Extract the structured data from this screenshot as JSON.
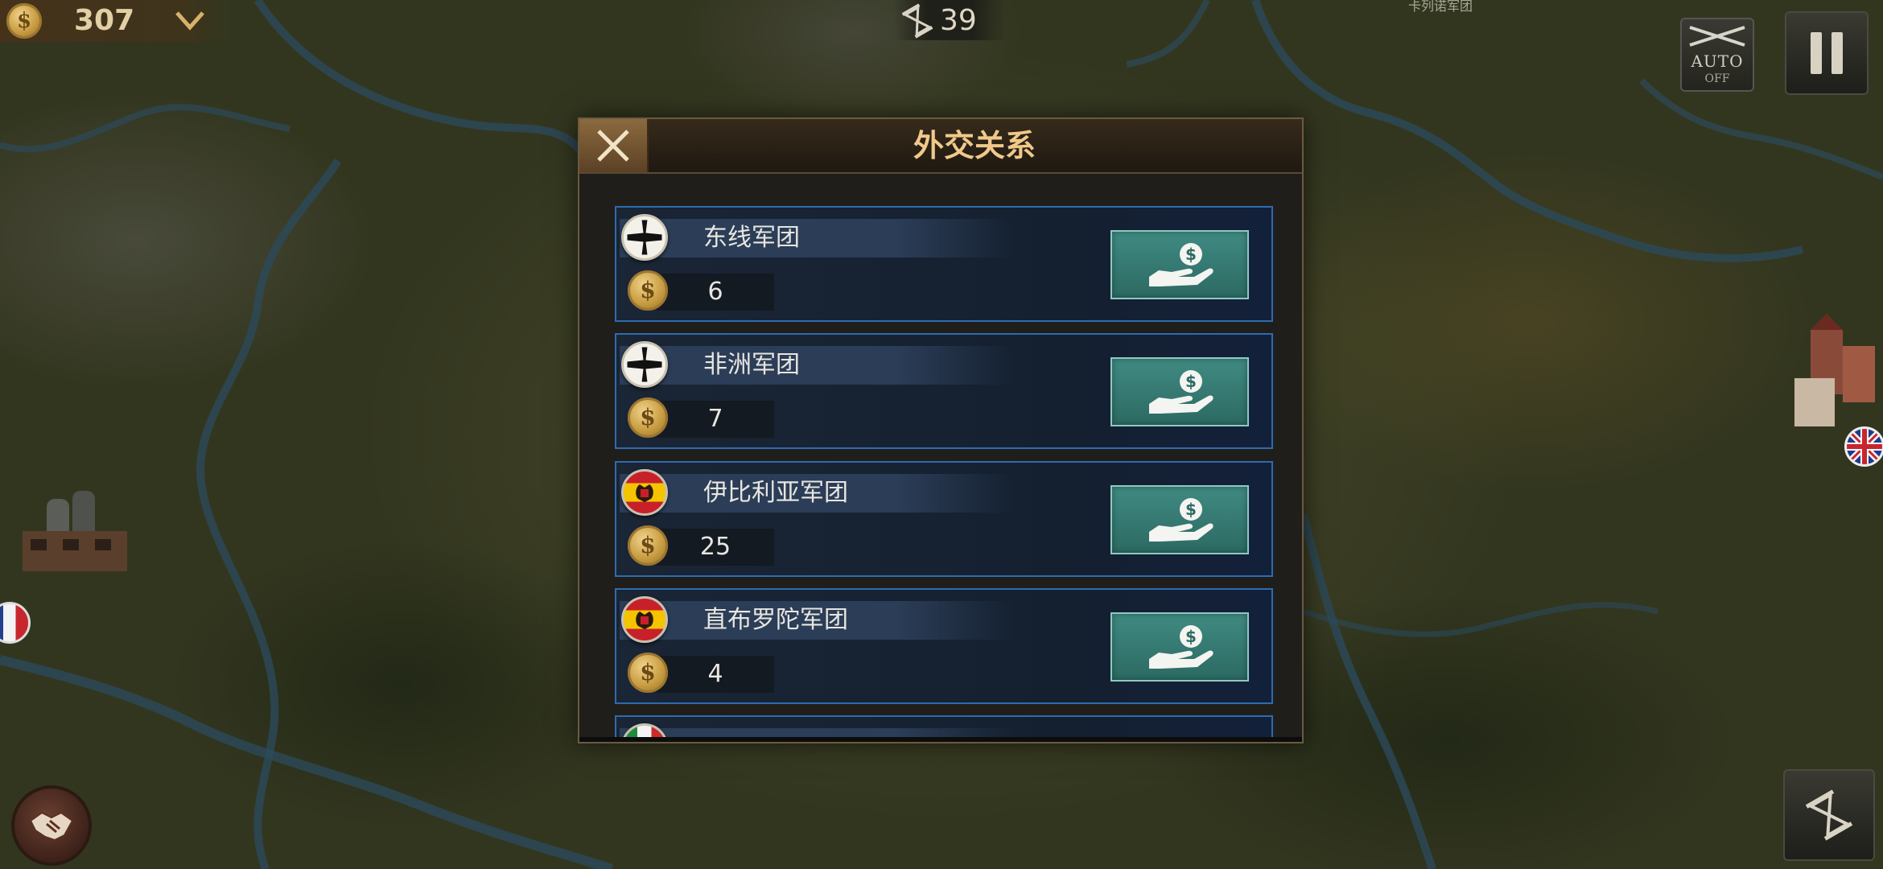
{
  "hud": {
    "gold": "307",
    "turn": "39",
    "auto_label": "AUTO",
    "auto_state": "OFF",
    "map_label": "卡列诺军团",
    "coin_symbol": "$"
  },
  "dialog": {
    "title": "外交关系",
    "factions": [
      {
        "name": "东线军团",
        "cost": "6",
        "flag": "iron-cross"
      },
      {
        "name": "非洲军团",
        "cost": "7",
        "flag": "iron-cross"
      },
      {
        "name": "伊比利亚军团",
        "cost": "25",
        "flag": "spain"
      },
      {
        "name": "直布罗陀军团",
        "cost": "4",
        "flag": "spain"
      },
      {
        "name": "",
        "cost": "",
        "flag": "italy"
      }
    ]
  },
  "icons": {
    "close": "close-icon",
    "bribe": "hand-money-icon",
    "pause": "pause-icon",
    "auto": "crossed-rifles-icon",
    "turn": "hourglass-icon",
    "diplomacy": "handshake-icon"
  },
  "colors": {
    "title": "#f0c98a",
    "bribe_button": "#3f8a82",
    "row_border": "#2d6bb0"
  }
}
